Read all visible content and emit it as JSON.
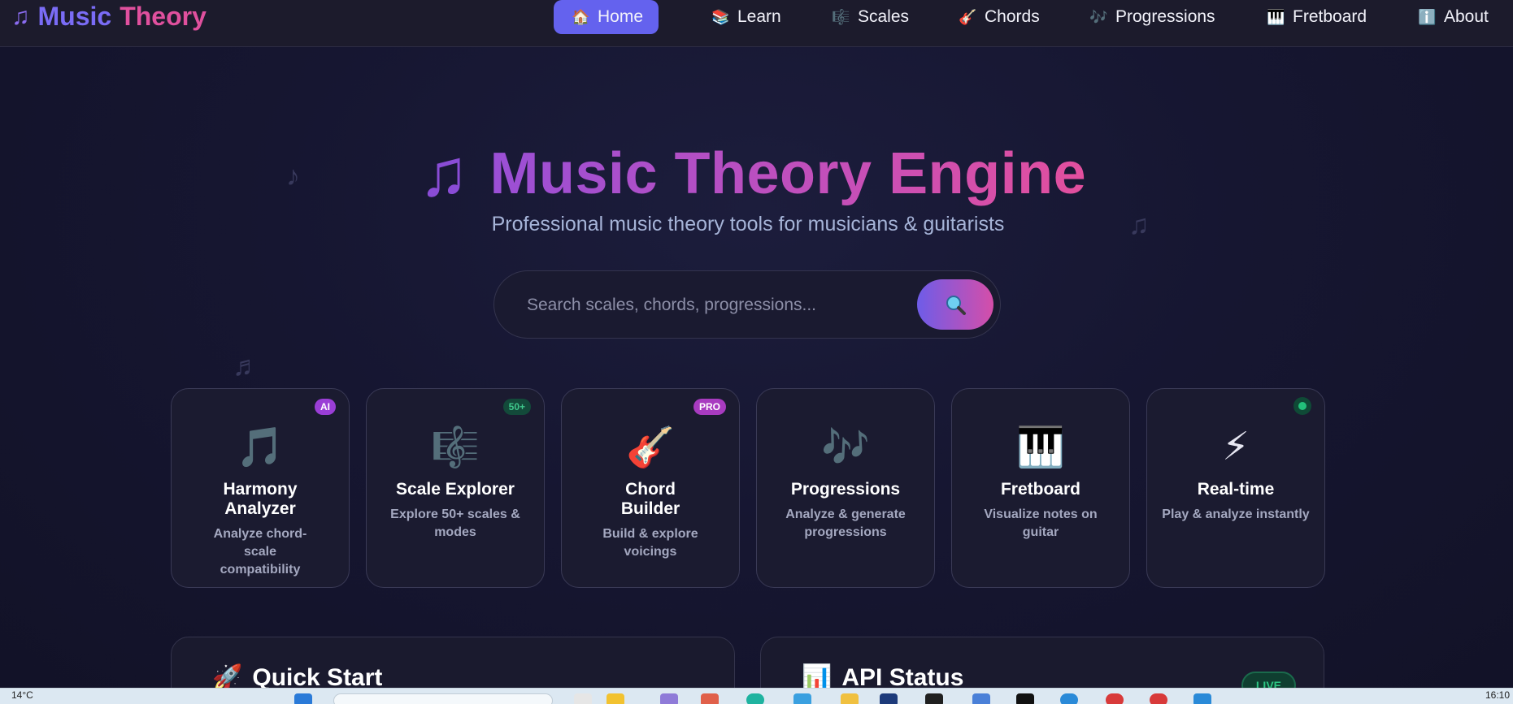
{
  "brand": {
    "icon": "music-note-icon",
    "word1": "Music",
    "word2": "Theory"
  },
  "nav": [
    {
      "icon": "house-icon",
      "glyph": "🏠",
      "label": "Home",
      "active": true
    },
    {
      "icon": "books-icon",
      "glyph": "📚",
      "label": "Learn",
      "active": false
    },
    {
      "icon": "scales-icon",
      "glyph": "🎼",
      "label": "Scales",
      "active": false
    },
    {
      "icon": "guitar-icon",
      "glyph": "🎸",
      "label": "Chords",
      "active": false
    },
    {
      "icon": "notes-icon",
      "glyph": "🎶",
      "label": "Progressions",
      "active": false
    },
    {
      "icon": "piano-icon",
      "glyph": "🎹",
      "label": "Fretboard",
      "active": false
    },
    {
      "icon": "info-icon",
      "glyph": "ℹ️",
      "label": "About",
      "active": false
    }
  ],
  "hero": {
    "title": "Music Theory Engine",
    "subtitle": "Professional music theory tools for musicians & guitarists",
    "search_placeholder": "Search scales, chords, progressions..."
  },
  "cards": [
    {
      "icon": "music-note-icon",
      "glyph": "🎵",
      "title": "Harmony Analyzer",
      "desc": "Analyze chord-scale compatibility",
      "badge": "AI",
      "badge_type": "ai"
    },
    {
      "icon": "sheet-music-icon",
      "glyph": "🎼",
      "title": "Scale Explorer",
      "desc": "Explore 50+ scales & modes",
      "badge": "50+",
      "badge_type": "num"
    },
    {
      "icon": "guitar-icon",
      "glyph": "🎸",
      "title": "Chord Builder",
      "desc": "Build & explore voicings",
      "badge": "PRO",
      "badge_type": "pro"
    },
    {
      "icon": "music-notes-icon",
      "glyph": "🎶",
      "title": "Progressions",
      "desc": "Analyze & generate progressions",
      "badge": "",
      "badge_type": ""
    },
    {
      "icon": "piano-icon",
      "glyph": "🎹",
      "title": "Fretboard",
      "desc": "Visualize notes on guitar",
      "badge": "",
      "badge_type": ""
    },
    {
      "icon": "lightning-icon",
      "glyph": "⚡",
      "title": "Real-time",
      "desc": "Play & analyze instantly",
      "badge": "",
      "badge_type": "dot"
    }
  ],
  "panels": {
    "quick_start": {
      "icon": "rocket-icon",
      "glyph": "🚀",
      "title": "Quick Start"
    },
    "api_status": {
      "icon": "chart-icon",
      "glyph": "📊",
      "title": "API Status",
      "badge": "LIVE"
    }
  },
  "taskbar": {
    "temperature": "14°C",
    "clock": "16:10"
  },
  "colors": {
    "accent": "#6462ee",
    "pink": "#e0509e",
    "purple": "#8a4cd6",
    "bg": "#161631"
  }
}
